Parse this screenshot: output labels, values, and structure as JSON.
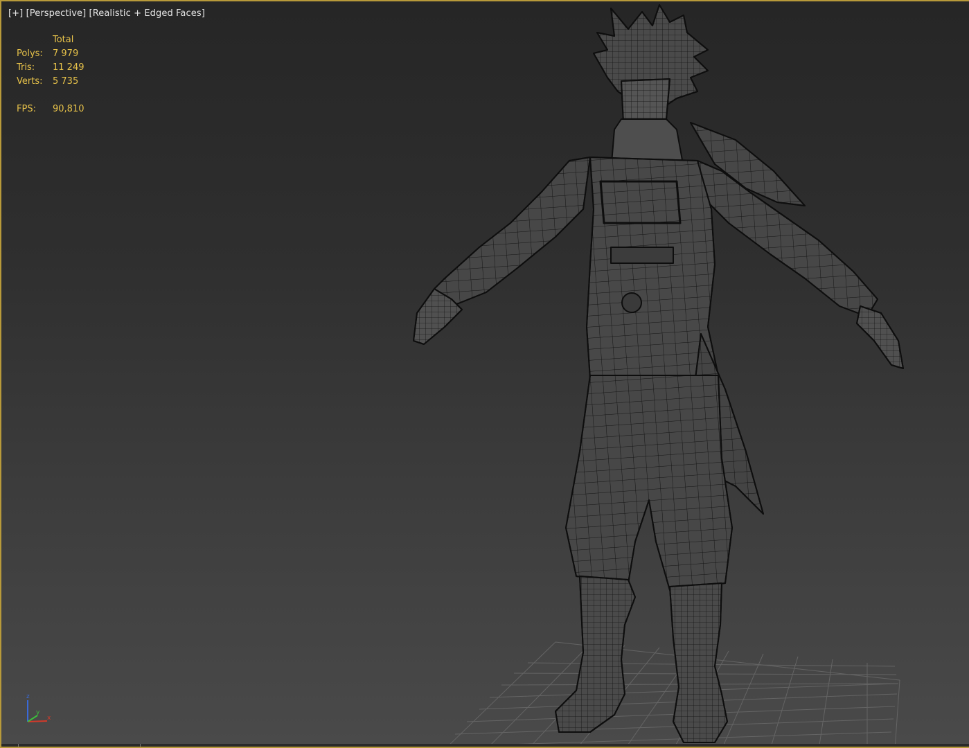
{
  "viewport": {
    "label_plus": "[+]",
    "label_view": "[Perspective]",
    "label_shading": "[Realistic + Edged Faces]"
  },
  "stats": {
    "header": "Total",
    "polys_label": "Polys:",
    "polys_value": "7 979",
    "tris_label": "Tris:",
    "tris_value": "11 249",
    "verts_label": "Verts:",
    "verts_value": "5 735",
    "fps_label": "FPS:",
    "fps_value": "90,810"
  },
  "gizmo": {
    "z": "z",
    "y": "y",
    "x": "x"
  },
  "colors": {
    "active_border": "#b89a3a",
    "stats_text": "#e8c34a",
    "label_text": "#e6e6e6",
    "axis_x": "#d33a2a",
    "axis_y": "#3cbf3c",
    "axis_z": "#3a6ad8"
  },
  "icons": [
    "axis-tripod-icon"
  ]
}
